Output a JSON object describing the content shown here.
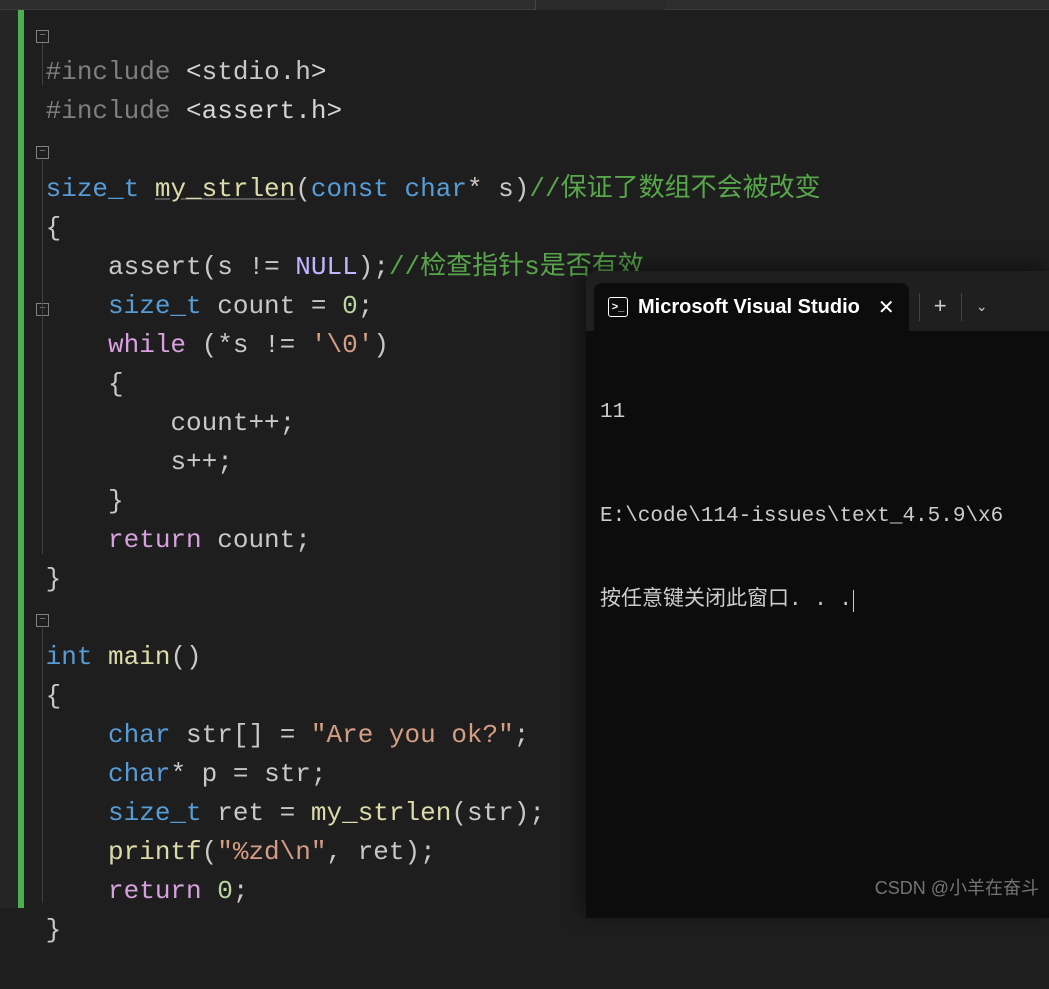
{
  "code": {
    "line1": {
      "include": "#include",
      "open": "<",
      "header": "stdio.h",
      "close": ">"
    },
    "line2": {
      "include": "#include",
      "open": "<",
      "header": "assert.h",
      "close": ">"
    },
    "line4": {
      "type": "size_t",
      "func": "my_strlen",
      "kw_const": "const",
      "kw_char": "char",
      "star": "*",
      "param": "s",
      "comment": "//保证了数组不会被改变"
    },
    "line5": {
      "brace": "{"
    },
    "line6": {
      "func": "assert",
      "param": "s",
      "op": "!=",
      "null": "NULL",
      "comment": "//检查指针s是否有效"
    },
    "line7": {
      "type": "size_t",
      "var": "count",
      "eq": "=",
      "num": "0"
    },
    "line8": {
      "kw_while": "while",
      "star": "*",
      "var": "s",
      "op": "!=",
      "lit": "'\\0'"
    },
    "line9": {
      "brace": "{"
    },
    "line10": {
      "var": "count",
      "op": "++"
    },
    "line11": {
      "var": "s",
      "op": "++"
    },
    "line12": {
      "brace": "}"
    },
    "line13": {
      "kw_return": "return",
      "var": "count"
    },
    "line14": {
      "brace": "}"
    },
    "line16": {
      "kw_int": "int",
      "func": "main"
    },
    "line17": {
      "brace": "{"
    },
    "line18": {
      "kw_char": "char",
      "var": "str",
      "brackets": "[]",
      "eq": "=",
      "str": "\"Are you ok?\""
    },
    "line19": {
      "kw_char": "char",
      "star": "*",
      "var": "p",
      "eq": "=",
      "rhs": "str"
    },
    "line20": {
      "type": "size_t",
      "var": "ret",
      "eq": "=",
      "func": "my_strlen",
      "arg": "str"
    },
    "line21": {
      "func": "printf",
      "fmt": "\"%zd\\n\"",
      "arg": "ret"
    },
    "line22": {
      "kw_return": "return",
      "num": "0"
    },
    "line23": {
      "brace": "}"
    }
  },
  "terminal": {
    "tab_title": "Microsoft Visual Studio",
    "output": "11",
    "path": "E:\\code\\114-issues\\text_4.5.9\\x6",
    "prompt": "按任意键关闭此窗口. . ."
  },
  "watermark": "CSDN @小羊在奋斗",
  "fold_minus": "−"
}
